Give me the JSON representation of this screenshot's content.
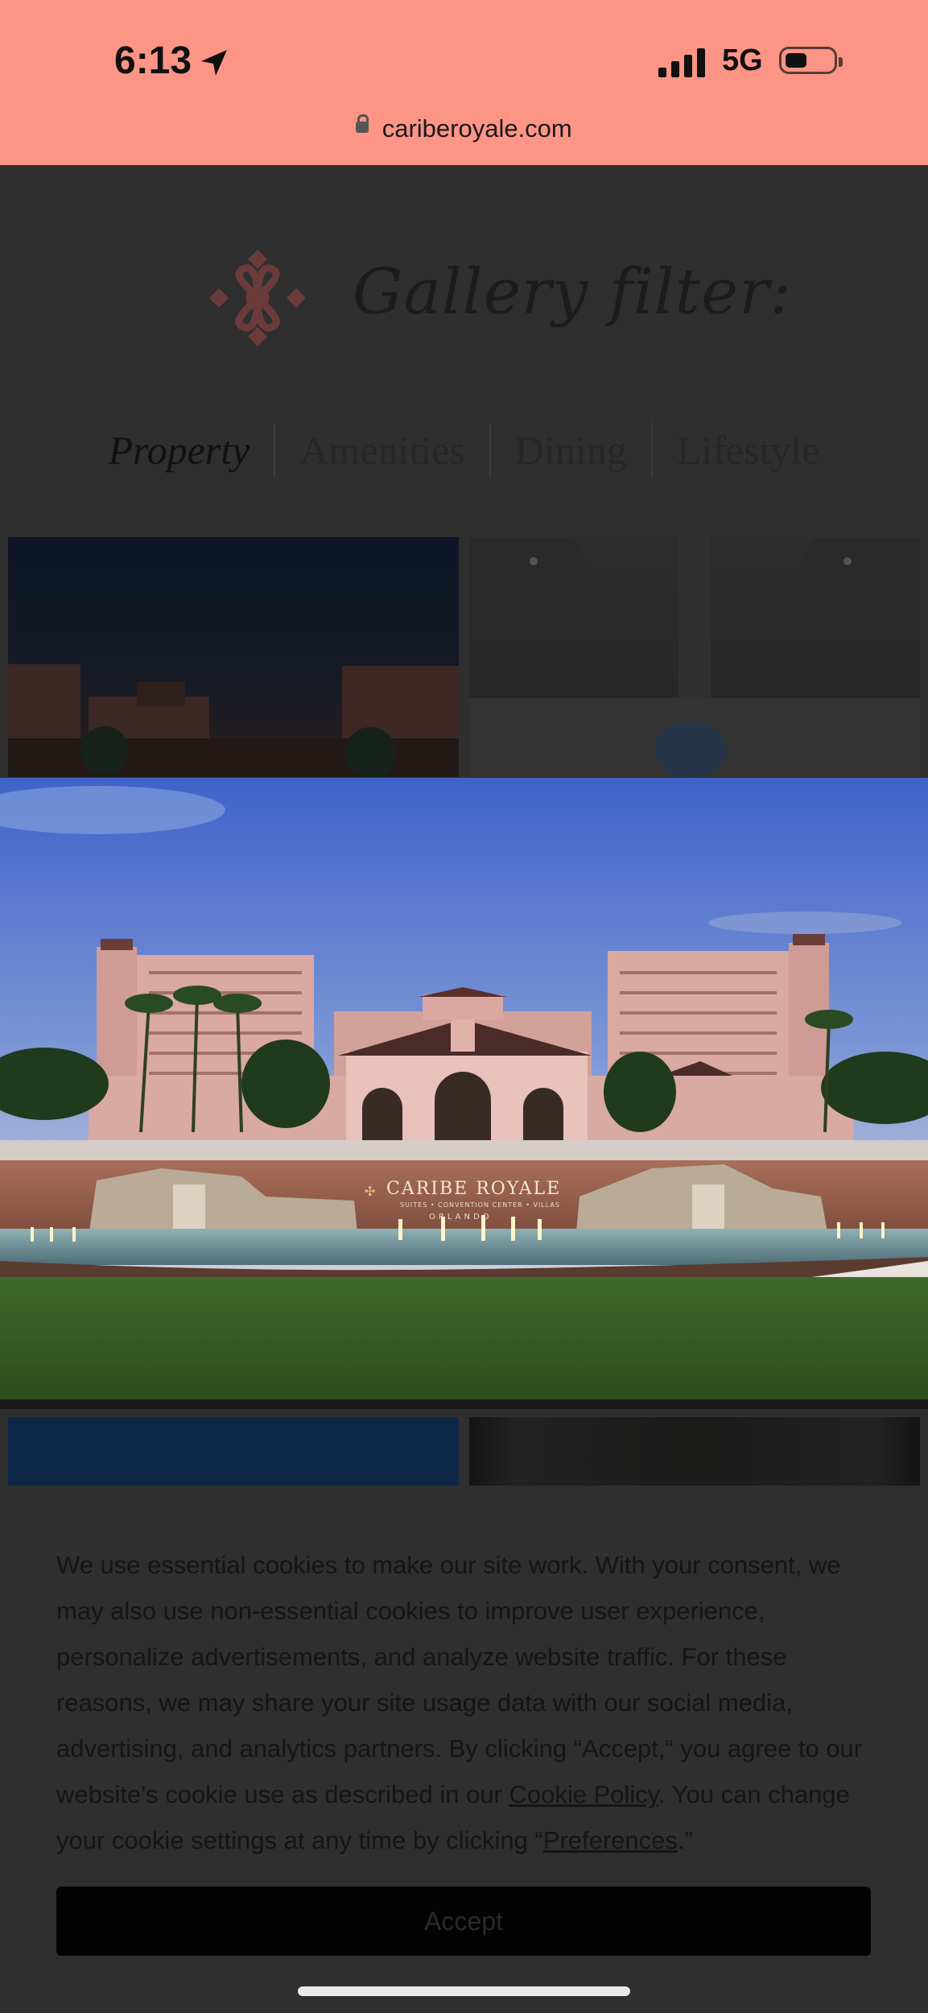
{
  "status_bar": {
    "time": "6:13",
    "network": "5G",
    "url": "cariberoyale.com",
    "icons": [
      "location-arrow-icon",
      "signal-icon",
      "battery-icon",
      "lock-icon"
    ]
  },
  "gallery": {
    "title": "Gallery filter:",
    "filters": [
      "Property",
      "Amenities",
      "Dining",
      "Lifestyle"
    ],
    "active_filter": "Property"
  },
  "hero": {
    "sign_line1": "CARIBE ROYALE",
    "sign_line2": "SUITES • CONVENTION CENTER • VILLAS",
    "sign_line3": "ORLANDO",
    "tower_sign": "CARIBE ROYALE"
  },
  "cookie_banner": {
    "text_part1": "We use essential cookies to make our site work. With your consent, we may also use non-essential cookies to improve user experience, personalize advertisements, and analyze website traffic. For these reasons, we may share your site usage data with our social media, advertising, and analytics partners. By clicking “Accept,“ you agree to our website's cookie use as described in our ",
    "cookie_policy_link": "Cookie Policy",
    "text_part2": ". You can change your cookie settings at any time by clicking “",
    "preferences_link": "Preferences",
    "text_part3": ".”",
    "accept_label": "Accept"
  },
  "colors": {
    "status_bar_bg": "#fd9587",
    "overlay_bg": "#2f2f2f",
    "accept_bg": "#030303",
    "emblem": "#6b3b3b"
  }
}
